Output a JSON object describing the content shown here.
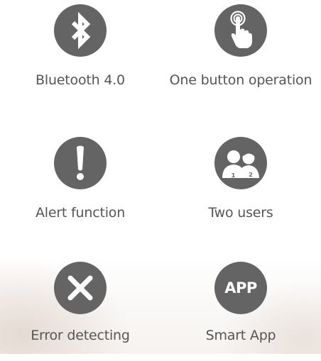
{
  "features": [
    {
      "label": "Bluetooth 4.0",
      "icon": "bluetooth-icon"
    },
    {
      "label": "One button operation",
      "icon": "finger-press-icon"
    },
    {
      "label": "Alert function",
      "icon": "exclamation-icon"
    },
    {
      "label": "Two users",
      "icon": "two-users-icon"
    },
    {
      "label": "Error detecting",
      "icon": "close-x-icon"
    },
    {
      "label": "Smart App",
      "icon": "app-icon",
      "icon_text": "APP"
    }
  ],
  "colors": {
    "icon_fill": "#646464",
    "label_text": "#555555",
    "icon_glyph": "#ffffff"
  }
}
